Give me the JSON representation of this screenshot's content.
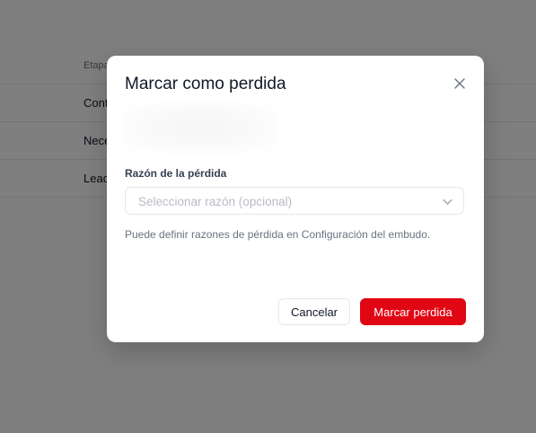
{
  "background": {
    "table": {
      "header": "Etapa",
      "rows": [
        "Contacto",
        "Necesidad",
        "Lead"
      ]
    }
  },
  "modal": {
    "title": "Marcar como perdida",
    "close_icon": "close-icon",
    "reason_field": {
      "label": "Razón de la pérdida",
      "placeholder": "Seleccionar razón (opcional)",
      "chevron_icon": "chevron-down-icon"
    },
    "help_text": "Puede definir razones de pérdida en Configuración del embudo.",
    "buttons": {
      "cancel": "Cancelar",
      "confirm": "Marcar perdida"
    }
  },
  "colors": {
    "primary": "#e10613",
    "overlay": "rgba(0,0,0,0.5)"
  }
}
